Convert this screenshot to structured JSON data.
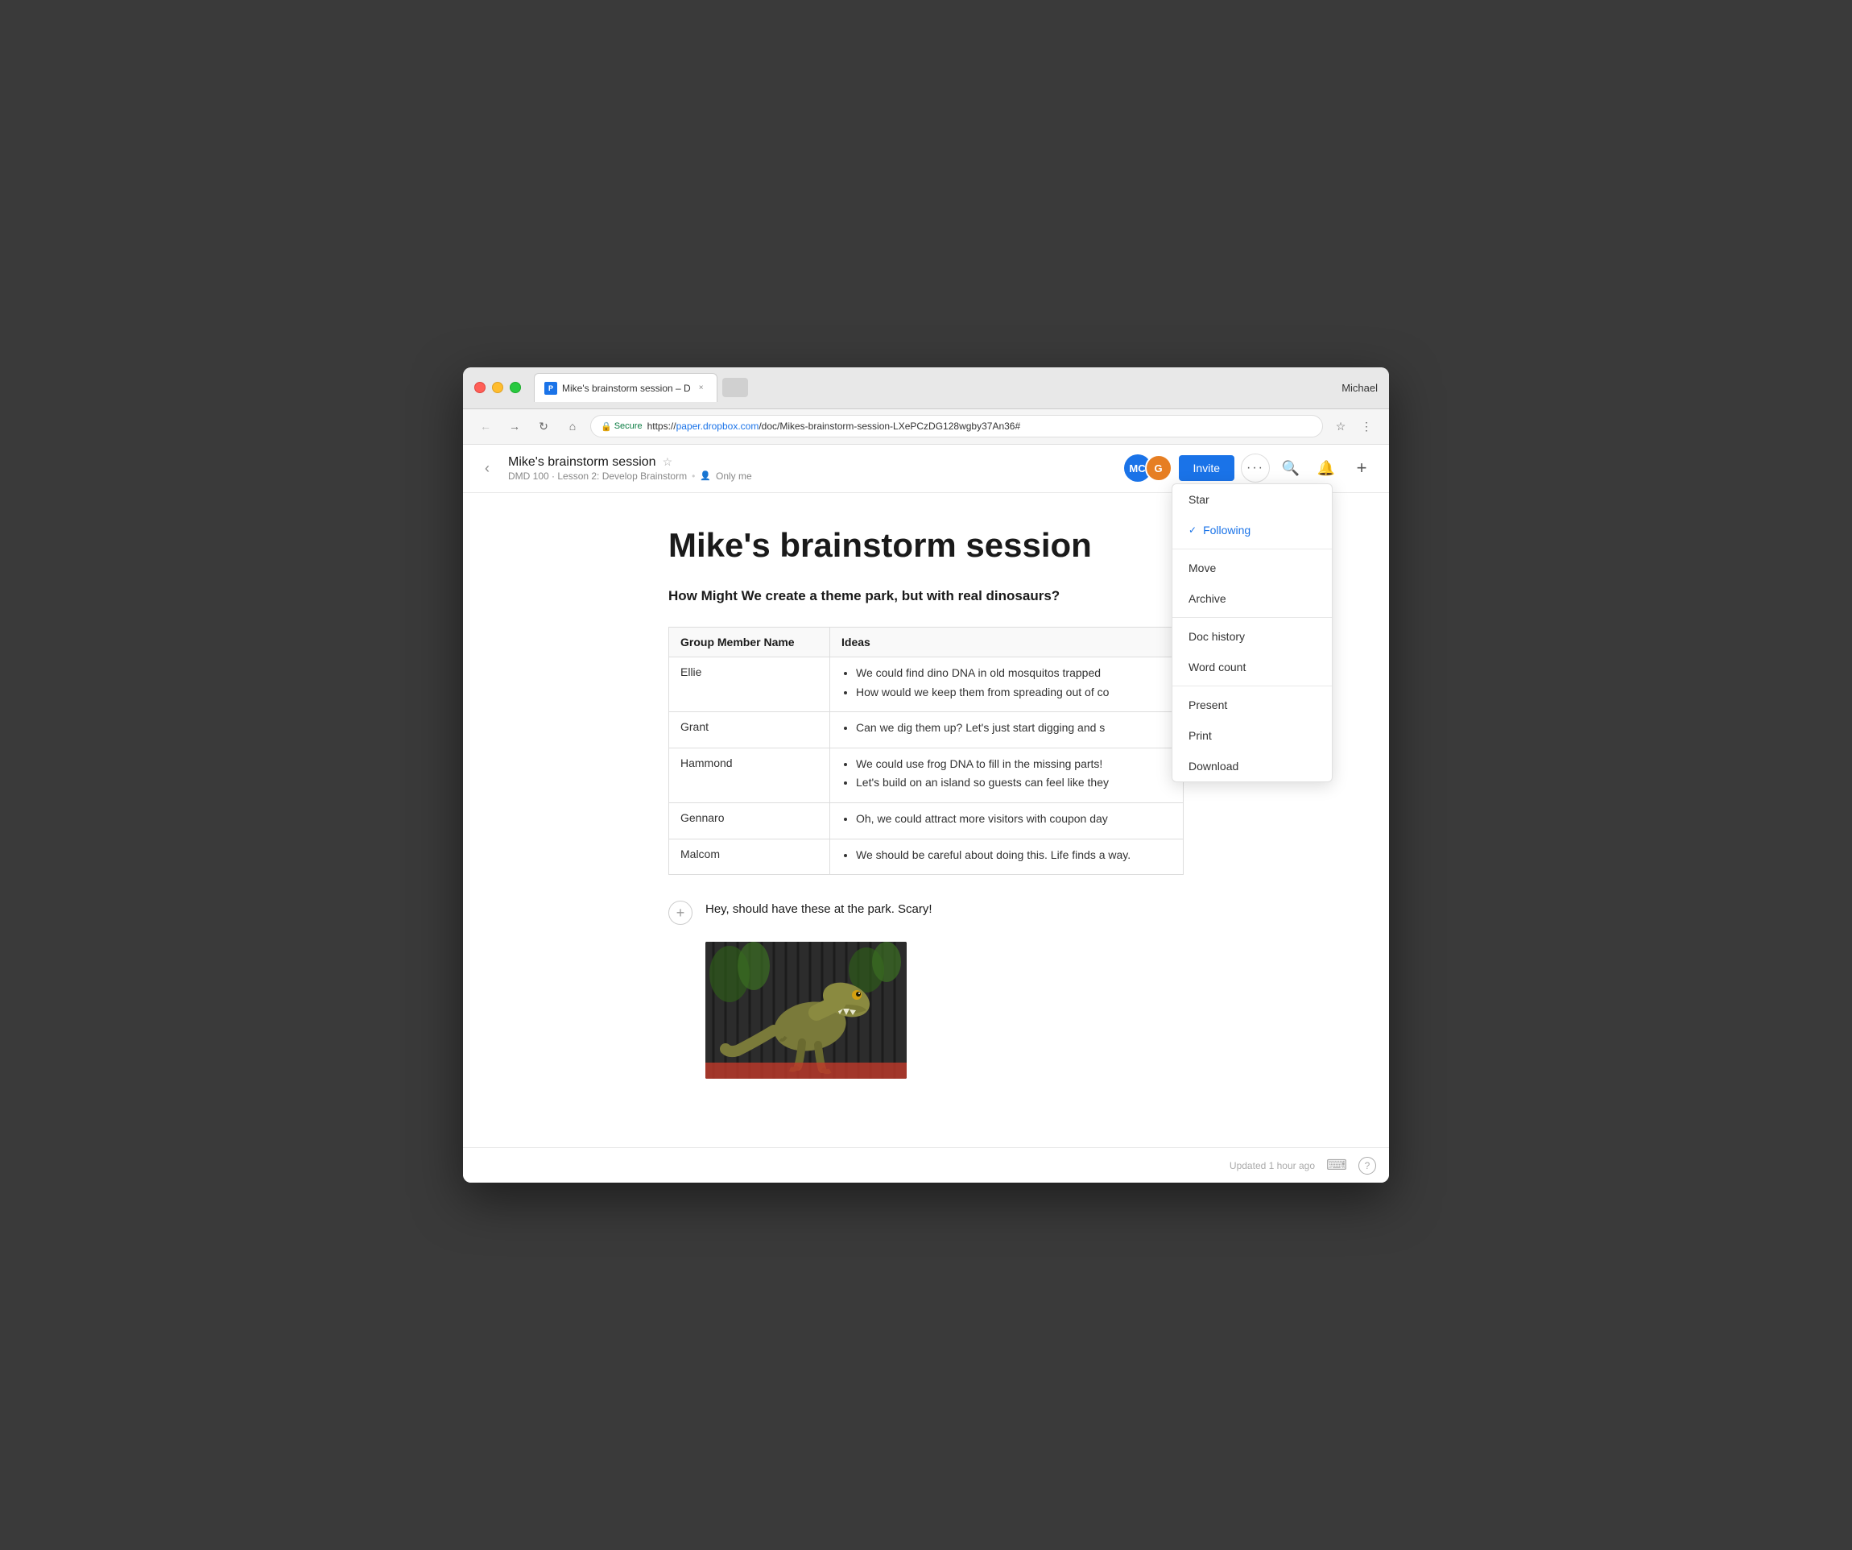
{
  "browser": {
    "user": "Michael",
    "tab": {
      "title": "Mike's brainstorm session – D",
      "favicon": "P"
    },
    "url": {
      "secure_label": "Secure",
      "full": "https://paper.dropbox.com/doc/Mikes-brainstorm-session-LXePCzDG128wgby37An36#",
      "display_protocol": "https://",
      "display_domain": "paper.dropbox.com",
      "display_path": "/doc/Mikes-brainstorm-session-LXePCzDG128wgby37An36#"
    }
  },
  "header": {
    "back_icon": "‹",
    "doc_title": "Mike's brainstorm session",
    "star_icon": "☆",
    "breadcrumb": "DMD 100 · Lesson 2: Develop Brainstorm",
    "visibility": "Only me",
    "invite_label": "Invite",
    "avatar_mc": "MC",
    "avatar_g": "G",
    "more_icon": "•••",
    "search_icon": "🔍",
    "bell_icon": "🔔",
    "plus_icon": "+"
  },
  "dropdown": {
    "items": [
      {
        "id": "star",
        "label": "Star",
        "active": false,
        "check": ""
      },
      {
        "id": "following",
        "label": "Following",
        "active": true,
        "check": "✓"
      },
      {
        "id": "move",
        "label": "Move",
        "active": false,
        "check": ""
      },
      {
        "id": "archive",
        "label": "Archive",
        "active": false,
        "check": ""
      },
      {
        "id": "doc-history",
        "label": "Doc history",
        "active": false,
        "check": ""
      },
      {
        "id": "word-count",
        "label": "Word count",
        "active": false,
        "check": ""
      },
      {
        "id": "present",
        "label": "Present",
        "active": false,
        "check": ""
      },
      {
        "id": "print",
        "label": "Print",
        "active": false,
        "check": ""
      },
      {
        "id": "download",
        "label": "Download",
        "active": false,
        "check": ""
      }
    ]
  },
  "content": {
    "main_title": "Mike's brainstorm session",
    "question": "How Might We create a theme park, but with real dinosaurs?",
    "table": {
      "headers": [
        "Group Member Name",
        "Ideas"
      ],
      "rows": [
        {
          "name": "Ellie",
          "ideas": [
            "We could find dino DNA in old mosquitos trapped",
            "How would we keep them from spreading out of co"
          ]
        },
        {
          "name": "Grant",
          "ideas": [
            "Can we dig them up? Let's just start digging and s"
          ]
        },
        {
          "name": "Hammond",
          "ideas": [
            "We could use frog DNA to fill in the missing parts!",
            "Let's build on an island so guests can feel like they"
          ]
        },
        {
          "name": "Gennaro",
          "ideas": [
            "Oh, we could attract more visitors with coupon day"
          ]
        },
        {
          "name": "Malcom",
          "ideas": [
            "We should be careful about doing this. Life finds a way."
          ]
        }
      ]
    },
    "after_table": "Hey, should have these at the park. Scary!",
    "add_block_icon": "+"
  },
  "status_bar": {
    "updated_text": "Updated 1 hour ago",
    "keyboard_icon": "⌨",
    "help_icon": "?"
  }
}
